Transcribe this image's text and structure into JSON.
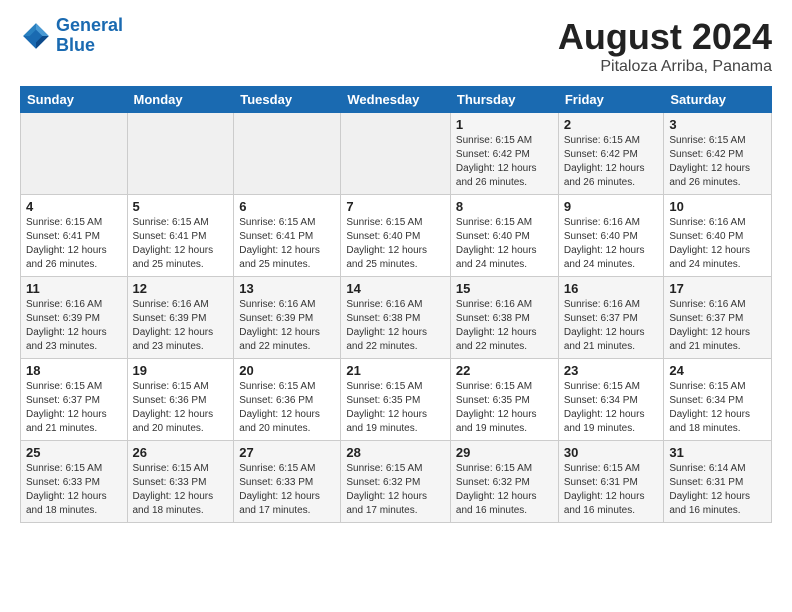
{
  "header": {
    "logo_line1": "General",
    "logo_line2": "Blue",
    "title": "August 2024",
    "subtitle": "Pitaloza Arriba, Panama"
  },
  "days_of_week": [
    "Sunday",
    "Monday",
    "Tuesday",
    "Wednesday",
    "Thursday",
    "Friday",
    "Saturday"
  ],
  "weeks": [
    [
      {
        "day": "",
        "info": ""
      },
      {
        "day": "",
        "info": ""
      },
      {
        "day": "",
        "info": ""
      },
      {
        "day": "",
        "info": ""
      },
      {
        "day": "1",
        "info": "Sunrise: 6:15 AM\nSunset: 6:42 PM\nDaylight: 12 hours\nand 26 minutes."
      },
      {
        "day": "2",
        "info": "Sunrise: 6:15 AM\nSunset: 6:42 PM\nDaylight: 12 hours\nand 26 minutes."
      },
      {
        "day": "3",
        "info": "Sunrise: 6:15 AM\nSunset: 6:42 PM\nDaylight: 12 hours\nand 26 minutes."
      }
    ],
    [
      {
        "day": "4",
        "info": "Sunrise: 6:15 AM\nSunset: 6:41 PM\nDaylight: 12 hours\nand 26 minutes."
      },
      {
        "day": "5",
        "info": "Sunrise: 6:15 AM\nSunset: 6:41 PM\nDaylight: 12 hours\nand 25 minutes."
      },
      {
        "day": "6",
        "info": "Sunrise: 6:15 AM\nSunset: 6:41 PM\nDaylight: 12 hours\nand 25 minutes."
      },
      {
        "day": "7",
        "info": "Sunrise: 6:15 AM\nSunset: 6:40 PM\nDaylight: 12 hours\nand 25 minutes."
      },
      {
        "day": "8",
        "info": "Sunrise: 6:15 AM\nSunset: 6:40 PM\nDaylight: 12 hours\nand 24 minutes."
      },
      {
        "day": "9",
        "info": "Sunrise: 6:16 AM\nSunset: 6:40 PM\nDaylight: 12 hours\nand 24 minutes."
      },
      {
        "day": "10",
        "info": "Sunrise: 6:16 AM\nSunset: 6:40 PM\nDaylight: 12 hours\nand 24 minutes."
      }
    ],
    [
      {
        "day": "11",
        "info": "Sunrise: 6:16 AM\nSunset: 6:39 PM\nDaylight: 12 hours\nand 23 minutes."
      },
      {
        "day": "12",
        "info": "Sunrise: 6:16 AM\nSunset: 6:39 PM\nDaylight: 12 hours\nand 23 minutes."
      },
      {
        "day": "13",
        "info": "Sunrise: 6:16 AM\nSunset: 6:39 PM\nDaylight: 12 hours\nand 22 minutes."
      },
      {
        "day": "14",
        "info": "Sunrise: 6:16 AM\nSunset: 6:38 PM\nDaylight: 12 hours\nand 22 minutes."
      },
      {
        "day": "15",
        "info": "Sunrise: 6:16 AM\nSunset: 6:38 PM\nDaylight: 12 hours\nand 22 minutes."
      },
      {
        "day": "16",
        "info": "Sunrise: 6:16 AM\nSunset: 6:37 PM\nDaylight: 12 hours\nand 21 minutes."
      },
      {
        "day": "17",
        "info": "Sunrise: 6:16 AM\nSunset: 6:37 PM\nDaylight: 12 hours\nand 21 minutes."
      }
    ],
    [
      {
        "day": "18",
        "info": "Sunrise: 6:15 AM\nSunset: 6:37 PM\nDaylight: 12 hours\nand 21 minutes."
      },
      {
        "day": "19",
        "info": "Sunrise: 6:15 AM\nSunset: 6:36 PM\nDaylight: 12 hours\nand 20 minutes."
      },
      {
        "day": "20",
        "info": "Sunrise: 6:15 AM\nSunset: 6:36 PM\nDaylight: 12 hours\nand 20 minutes."
      },
      {
        "day": "21",
        "info": "Sunrise: 6:15 AM\nSunset: 6:35 PM\nDaylight: 12 hours\nand 19 minutes."
      },
      {
        "day": "22",
        "info": "Sunrise: 6:15 AM\nSunset: 6:35 PM\nDaylight: 12 hours\nand 19 minutes."
      },
      {
        "day": "23",
        "info": "Sunrise: 6:15 AM\nSunset: 6:34 PM\nDaylight: 12 hours\nand 19 minutes."
      },
      {
        "day": "24",
        "info": "Sunrise: 6:15 AM\nSunset: 6:34 PM\nDaylight: 12 hours\nand 18 minutes."
      }
    ],
    [
      {
        "day": "25",
        "info": "Sunrise: 6:15 AM\nSunset: 6:33 PM\nDaylight: 12 hours\nand 18 minutes."
      },
      {
        "day": "26",
        "info": "Sunrise: 6:15 AM\nSunset: 6:33 PM\nDaylight: 12 hours\nand 18 minutes."
      },
      {
        "day": "27",
        "info": "Sunrise: 6:15 AM\nSunset: 6:33 PM\nDaylight: 12 hours\nand 17 minutes."
      },
      {
        "day": "28",
        "info": "Sunrise: 6:15 AM\nSunset: 6:32 PM\nDaylight: 12 hours\nand 17 minutes."
      },
      {
        "day": "29",
        "info": "Sunrise: 6:15 AM\nSunset: 6:32 PM\nDaylight: 12 hours\nand 16 minutes."
      },
      {
        "day": "30",
        "info": "Sunrise: 6:15 AM\nSunset: 6:31 PM\nDaylight: 12 hours\nand 16 minutes."
      },
      {
        "day": "31",
        "info": "Sunrise: 6:14 AM\nSunset: 6:31 PM\nDaylight: 12 hours\nand 16 minutes."
      }
    ]
  ]
}
